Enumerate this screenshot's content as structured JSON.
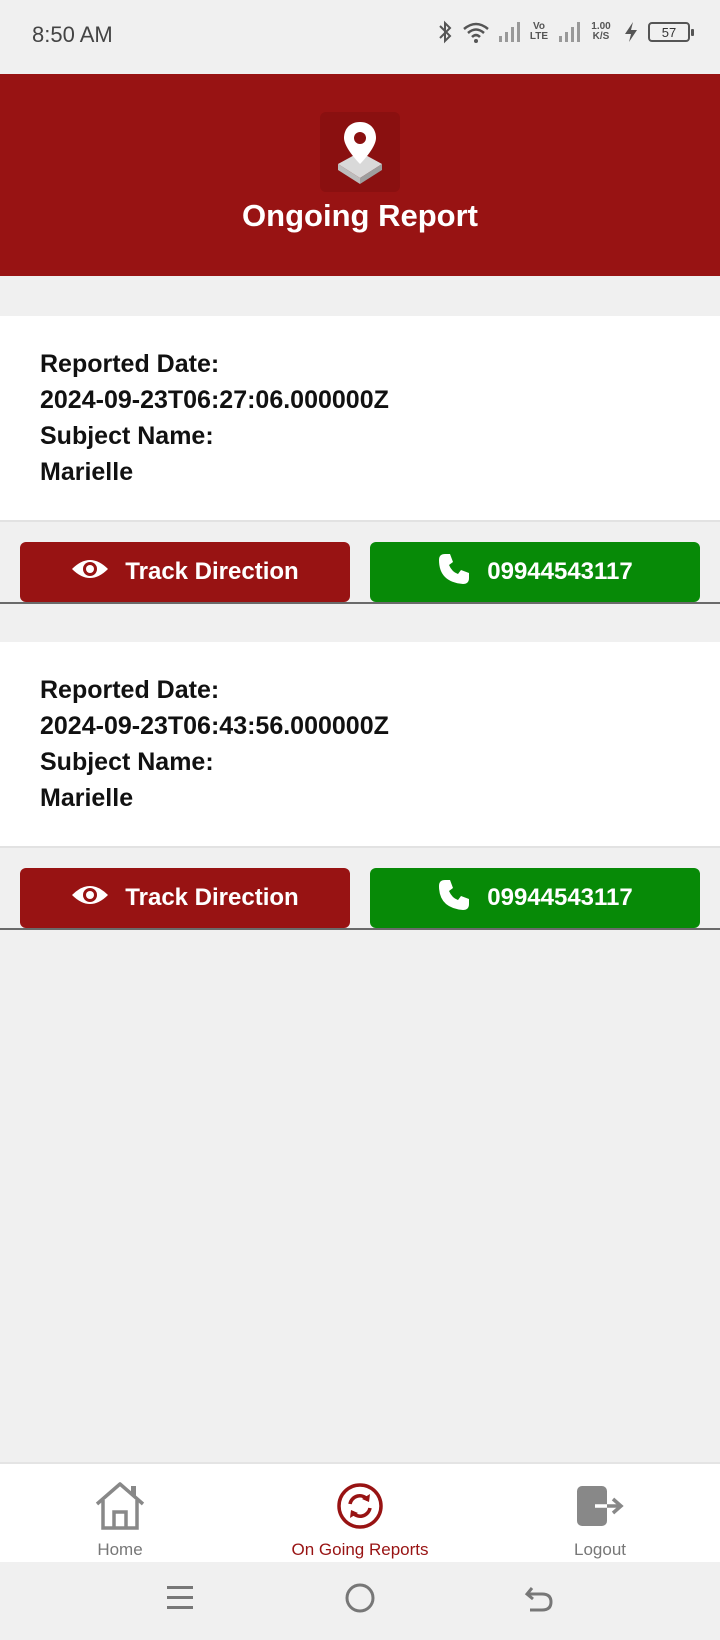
{
  "status_bar": {
    "time": "8:50 AM",
    "volte": "Vo LTE",
    "speed": "1.00 K/S",
    "battery": "57"
  },
  "header": {
    "title": "Ongoing Report",
    "logo_icon": "location-pin-icon"
  },
  "reports": [
    {
      "date_label": "Reported Date:",
      "date": "2024-09-23T06:27:06.000000Z",
      "subject_label": "Subject Name:",
      "subject": "Marielle",
      "track_label": "Track Direction",
      "phone": "09944543117"
    },
    {
      "date_label": "Reported Date:",
      "date": "2024-09-23T06:43:56.000000Z",
      "subject_label": "Subject Name:",
      "subject": "Marielle",
      "track_label": "Track Direction",
      "phone": "09944543117"
    }
  ],
  "bottom_nav": [
    {
      "label": "Home",
      "icon": "home-icon",
      "active": false
    },
    {
      "label": "On Going Reports",
      "icon": "refresh-icon",
      "active": true
    },
    {
      "label": "Logout",
      "icon": "logout-icon",
      "active": false
    }
  ],
  "colors": {
    "primary": "#981313",
    "call_green": "#078a07",
    "background": "#f0f0f0"
  }
}
